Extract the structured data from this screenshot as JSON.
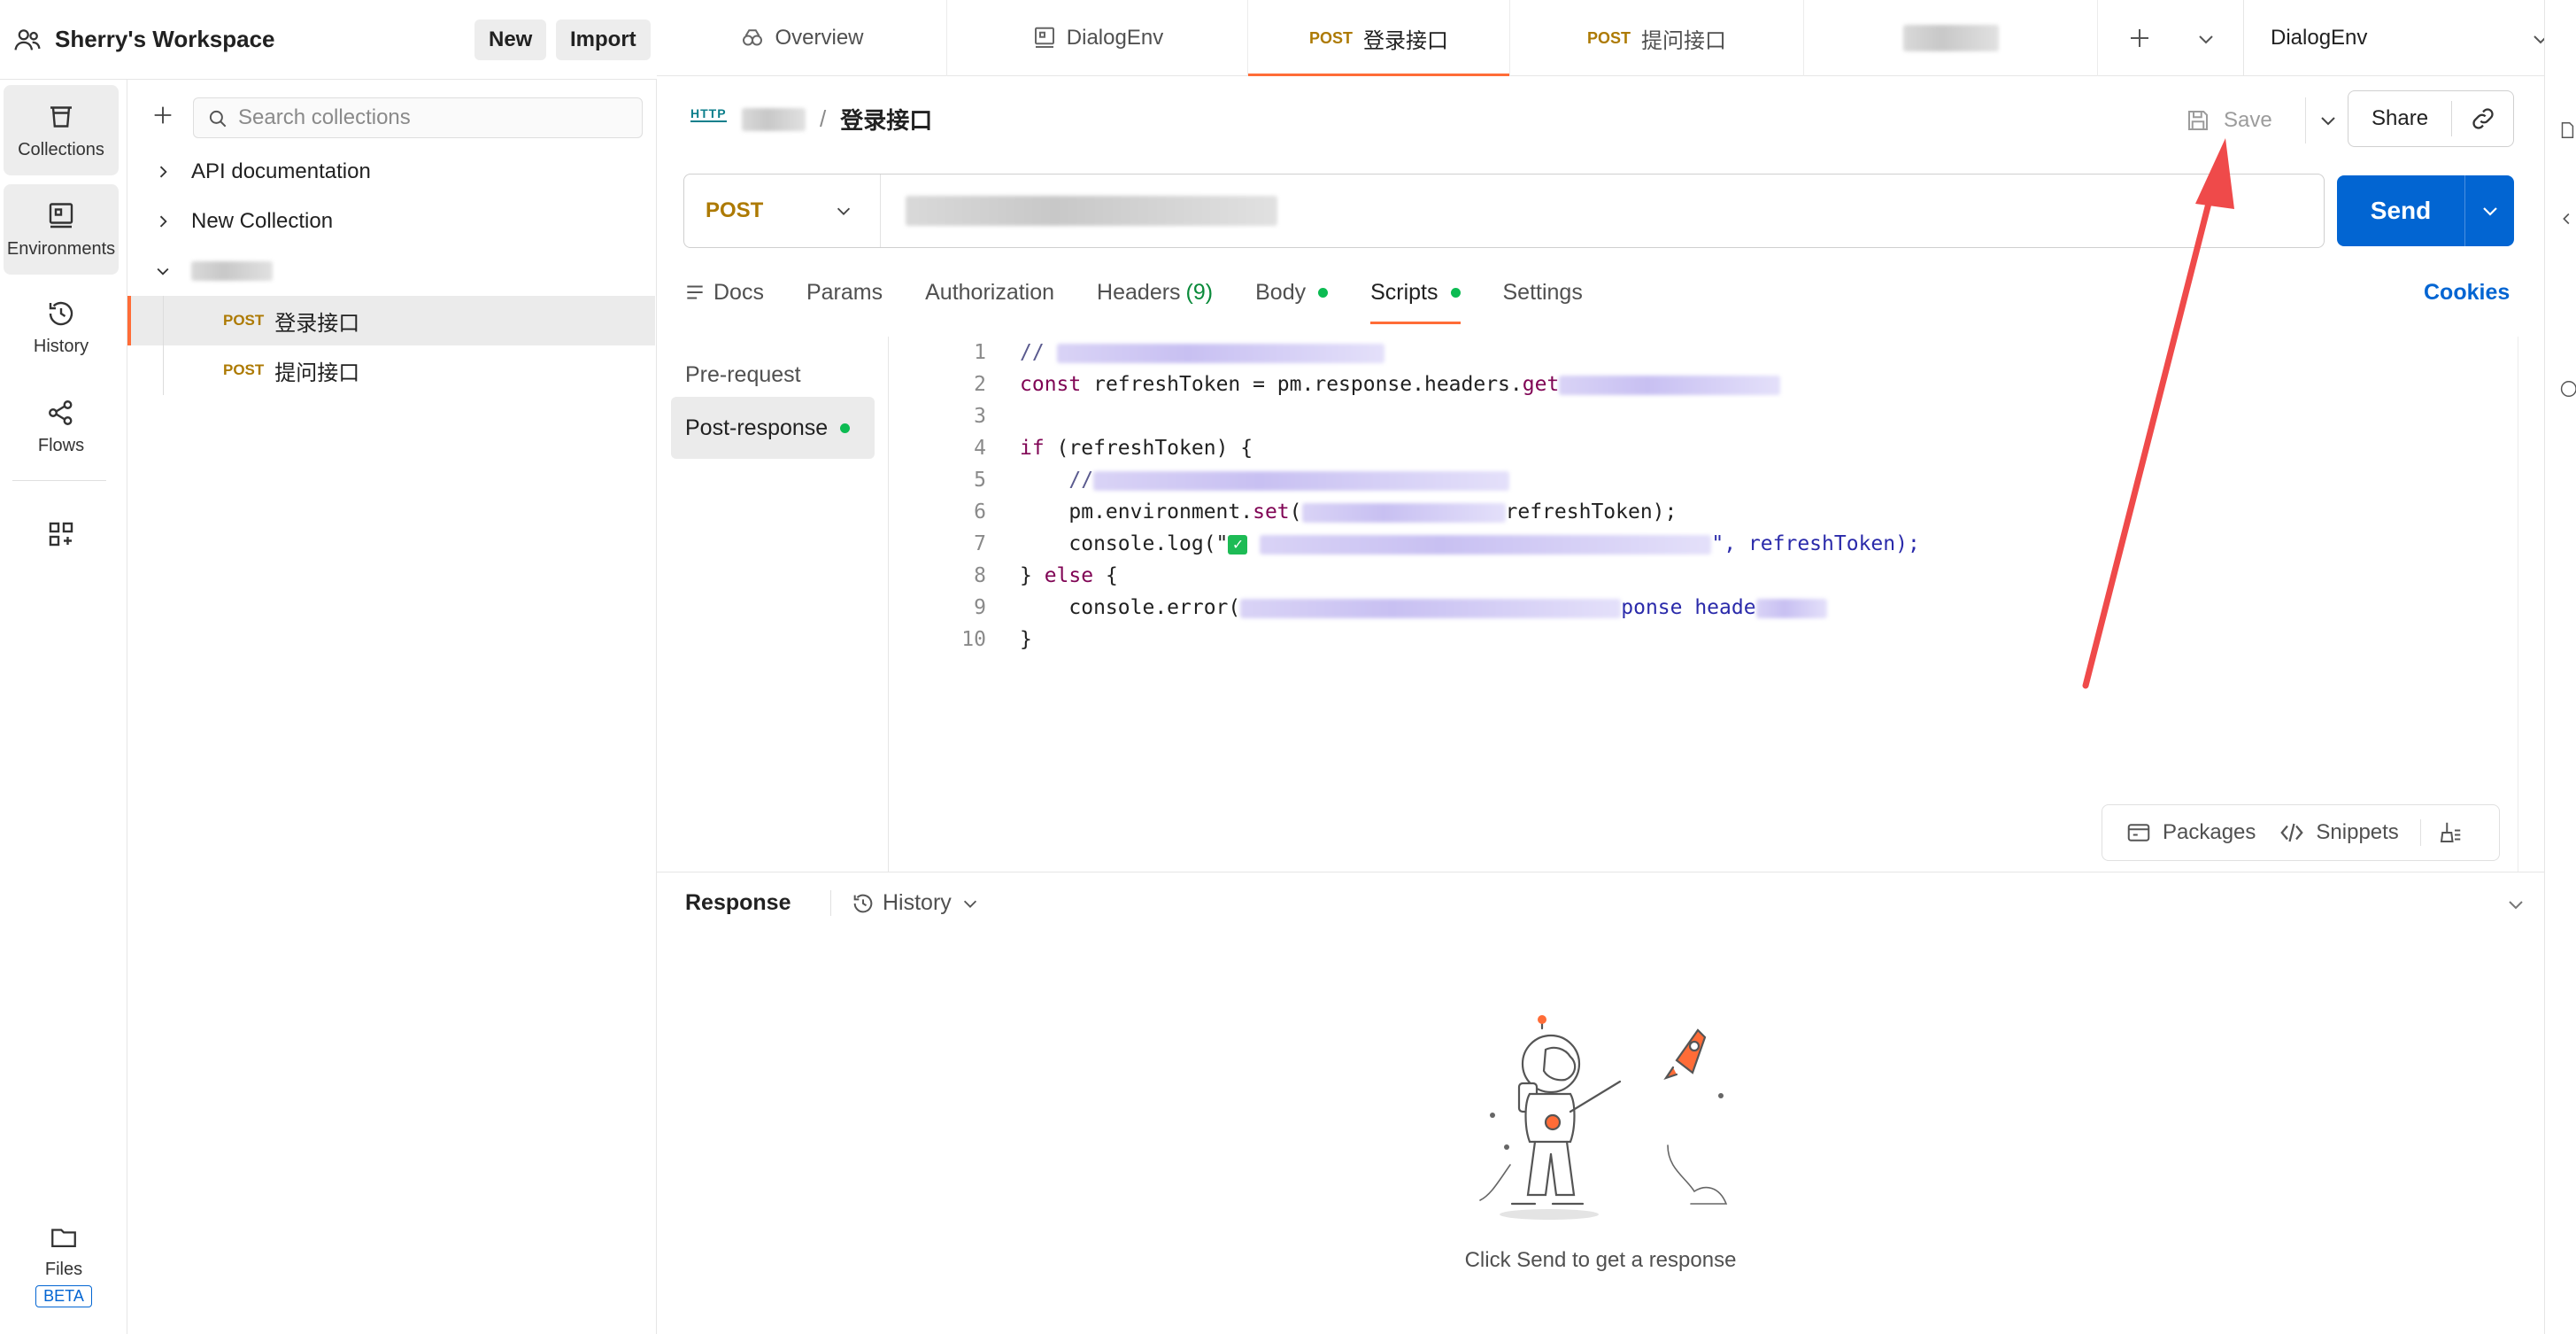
{
  "workspace": {
    "name": "Sherry's Workspace",
    "new_label": "New",
    "import_label": "Import"
  },
  "rail": {
    "items": [
      {
        "label": "Collections",
        "icon": "trash-bin-icon"
      },
      {
        "label": "Environments",
        "icon": "environment-icon"
      },
      {
        "label": "History",
        "icon": "history-icon"
      },
      {
        "label": "Flows",
        "icon": "flows-icon"
      }
    ],
    "files_label": "Files",
    "beta_label": "BETA"
  },
  "sidebar": {
    "search_placeholder": "Search collections",
    "tree": [
      {
        "label": "API documentation"
      },
      {
        "label": "New Collection"
      }
    ],
    "requests": [
      {
        "method": "POST",
        "label": "登录接口"
      },
      {
        "method": "POST",
        "label": "提问接口"
      }
    ]
  },
  "tabs": [
    {
      "label": "Overview",
      "icon": "overview-icon"
    },
    {
      "label": "DialogEnv",
      "icon": "environment-icon"
    },
    {
      "method": "POST",
      "label": "登录接口"
    },
    {
      "method": "POST",
      "label": "提问接口"
    }
  ],
  "environment": {
    "selected": "DialogEnv"
  },
  "request": {
    "http_badge": "HTTP",
    "breadcrumb_sep": "/",
    "name": "登录接口",
    "save_label": "Save",
    "share_label": "Share",
    "method": "POST",
    "send_label": "Send"
  },
  "request_tabs": [
    {
      "label": "Docs"
    },
    {
      "label": "Params"
    },
    {
      "label": "Authorization"
    },
    {
      "label": "Headers",
      "count": "(9)"
    },
    {
      "label": "Body"
    },
    {
      "label": "Scripts"
    },
    {
      "label": "Settings"
    }
  ],
  "cookies_label": "Cookies",
  "scripts": {
    "pre_request": "Pre-request",
    "post_response": "Post-response",
    "line_numbers": [
      "1",
      "2",
      "3",
      "4",
      "5",
      "6",
      "7",
      "8",
      "9",
      "10"
    ],
    "code": {
      "l1": "// ",
      "l2a": "const",
      "l2b": " refreshToken = pm.response.headers.",
      "l2c": "get",
      "l4a": "if",
      "l4b": " (refreshToken) {",
      "l5": "    //",
      "l6a": "    pm.environment.",
      "l6b": "set",
      "l6c": "(",
      "l6d": "refreshToken);",
      "l7a": "    console.log(\"",
      "l7b": "\", refreshToken);",
      "l8a": "} ",
      "l8b": "else",
      "l8c": " {",
      "l9a": "    console.error(",
      "l9b": "ponse heade",
      "l10": "}"
    },
    "packages_label": "Packages",
    "snippets_label": "Snippets"
  },
  "response": {
    "title": "Response",
    "history_label": "History",
    "empty_message": "Click Send to get a response"
  },
  "colors": {
    "accent": "#ff6c37",
    "primary": "#0265d2",
    "method_post": "#ad7a03",
    "annotation": "#ef4a4a"
  }
}
